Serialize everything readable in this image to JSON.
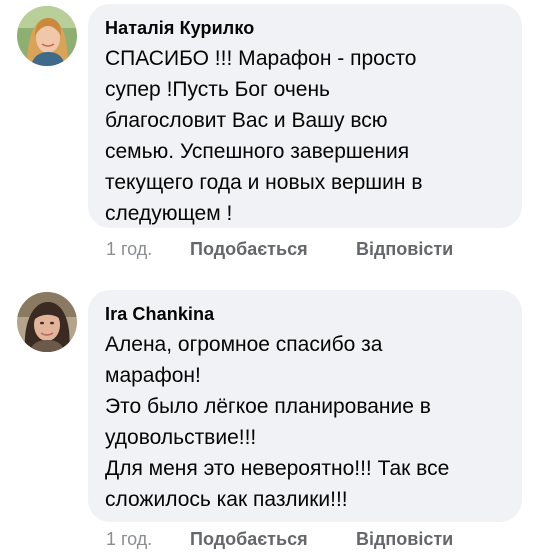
{
  "comments": [
    {
      "author": "Наталія Курилко",
      "text": "СПАСИБО !!! Марафон - просто\nсупер !Пусть Бог очень\nблагословит Вас и Вашу всю\nсемью. Успешного завершения\nтекущего года и новых вершин в\nследующем !",
      "time": "1 год.",
      "like": "Подобається",
      "reply": "Відповісти"
    },
    {
      "author": "Ira Chankina",
      "text": "Алена, огромное спасибо за\nмарафон!\nЭто было лёгкое планирование в\nудовольствие!!!\nДля меня это невероятно!!! Так все\nсложилось как пазлики!!!",
      "time": "1 год.",
      "like": "Подобається",
      "reply": "Відповісти"
    }
  ],
  "colors": {
    "bubble": "#f0f2f5",
    "text": "#050505",
    "secondary": "#65676b",
    "timestamp": "#8a8d91"
  }
}
